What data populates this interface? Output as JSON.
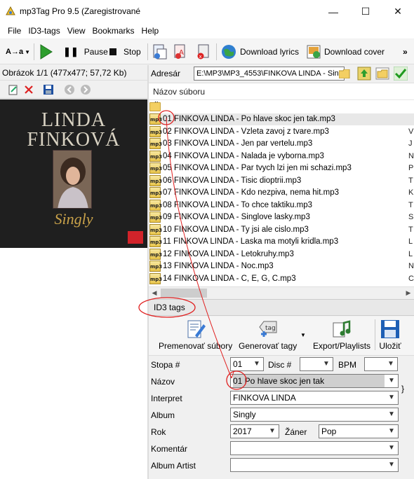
{
  "window": {
    "title": "mp3Tag Pro 9.5 (Zaregistrované",
    "minimize_glyph": "—",
    "maximize_glyph": "☐",
    "close_glyph": "✕"
  },
  "menu": {
    "items": [
      {
        "label": "File"
      },
      {
        "label": "ID3-tags"
      },
      {
        "label": "View"
      },
      {
        "label": "Bookmarks"
      },
      {
        "label": "Help"
      }
    ]
  },
  "toolbar": {
    "case_label": "A→a",
    "pause_label": "Pause",
    "stop_label": "Stop",
    "download_lyrics_label": "Download lyrics",
    "download_cover_label": "Download cover",
    "overflow_glyph": "»"
  },
  "left_panel": {
    "image_info": "Obrázok 1/1 (477x477; 57,72 Kb)",
    "cover": {
      "artist_line1": "LINDA",
      "artist_line2": "FINKOVÁ",
      "album_title": "Singly",
      "logo_text": "supraphon"
    }
  },
  "address": {
    "label": "Adresár",
    "value": "E:\\MP3\\MP3_4553\\FINKOVA LINDA - Sing"
  },
  "file_list": {
    "column_header": "Názov súboru",
    "parent_folder": "..",
    "icon_text": "mp3",
    "files": [
      {
        "name": "01 FINKOVA LINDA - Po hlave skoc jen tak.mp3",
        "side": "",
        "selected": true
      },
      {
        "name": "02 FINKOVA LINDA - Vzleta zavoj z tvare.mp3",
        "side": "V"
      },
      {
        "name": "03 FINKOVA LINDA - Jen par vertelu.mp3",
        "side": "J"
      },
      {
        "name": "04 FINKOVA LINDA - Nalada je vyborna.mp3",
        "side": "N"
      },
      {
        "name": "05 FINKOVA LINDA - Par tvych lzi jen mi schazi.mp3",
        "side": "P"
      },
      {
        "name": "06 FINKOVA LINDA - Tisic dioptrii.mp3",
        "side": "T"
      },
      {
        "name": "07 FINKOVA LINDA - Kdo nezpiva, nema hit.mp3",
        "side": "K"
      },
      {
        "name": "08 FINKOVA LINDA - To chce taktiku.mp3",
        "side": "T"
      },
      {
        "name": "09 FINKOVA LINDA - Singlove lasky.mp3",
        "side": "S"
      },
      {
        "name": "10 FINKOVA LINDA - Ty jsi ale cislo.mp3",
        "side": "T"
      },
      {
        "name": "11 FINKOVA LINDA - Laska ma motyli kridla.mp3",
        "side": "L"
      },
      {
        "name": "12 FINKOVA LINDA - Letokruhy.mp3",
        "side": "L"
      },
      {
        "name": "13 FINKOVA LINDA - Noc.mp3",
        "side": "N"
      },
      {
        "name": "14 FINKOVA LINDA - C, E, G, C.mp3",
        "side": "C"
      }
    ]
  },
  "id3": {
    "header": "ID3 tags",
    "tools": {
      "rename_label": "Premenovať súbory",
      "generate_label": "Generovať tagy",
      "export_label": "Export/Playlists",
      "save_label": "Uložiť"
    },
    "fields": {
      "track_label": "Stopa #",
      "track_value": "01",
      "disc_label": "Disc #",
      "disc_value": "",
      "bpm_label": "BPM",
      "bpm_value": "",
      "title_label": "Názov",
      "title_value": "01 Po hlave skoc jen tak",
      "artist_label": "Interpret",
      "artist_value": "FINKOVA LINDA",
      "album_label": "Album",
      "album_value": "Singly",
      "year_label": "Rok",
      "year_value": "2017",
      "genre_label": "Žáner",
      "genre_value": "Pop",
      "comment_label": "Komentár",
      "comment_value": "",
      "album_artist_label": "Album Artist",
      "album_artist_value": "",
      "brace": "}"
    }
  },
  "colors": {
    "accent_green": "#2e9e2e",
    "annotation_red": "#e02020",
    "selection_gray": "#cfcfcf"
  }
}
